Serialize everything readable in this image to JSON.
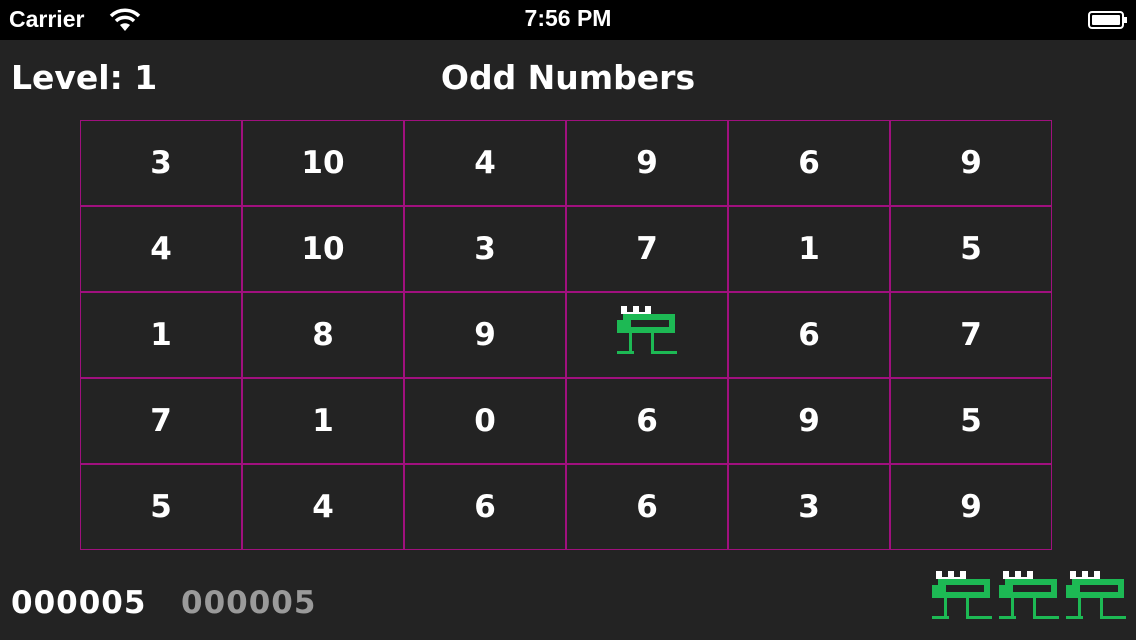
{
  "statusbar": {
    "carrier": "Carrier",
    "time": "7:56 PM"
  },
  "game": {
    "level_label": "Level: 1",
    "title": "Odd Numbers",
    "score": "000005",
    "high_score": "000005",
    "lives": 3,
    "grid_color": "#a0107e",
    "player_color": "#1db954",
    "player_position": {
      "row": 2,
      "col": 3
    },
    "grid": [
      [
        "3",
        "10",
        "4",
        "9",
        "6",
        "9"
      ],
      [
        "4",
        "10",
        "3",
        "7",
        "1",
        "5"
      ],
      [
        "1",
        "8",
        "9",
        "",
        "6",
        "7"
      ],
      [
        "7",
        "1",
        "0",
        "6",
        "9",
        "5"
      ],
      [
        "5",
        "4",
        "6",
        "6",
        "3",
        "9"
      ]
    ]
  }
}
